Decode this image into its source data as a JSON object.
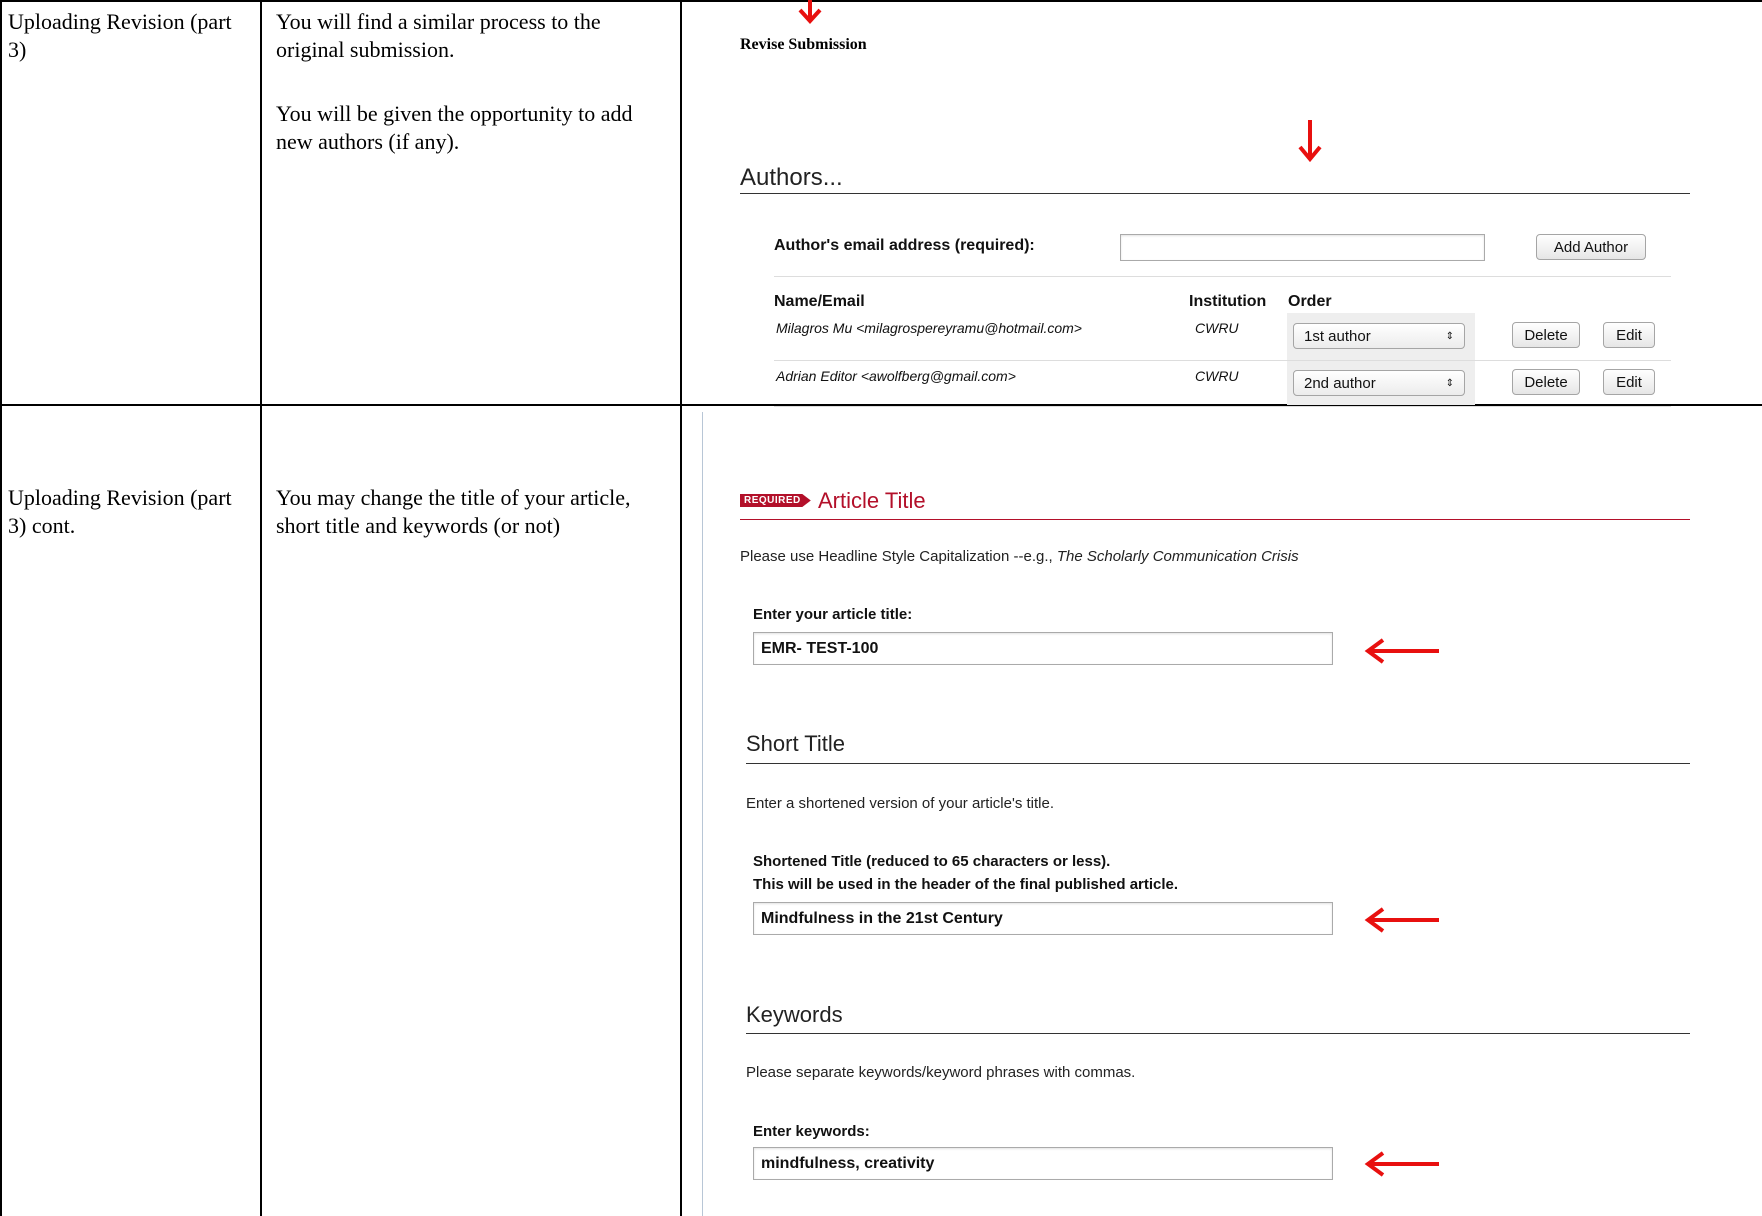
{
  "rows": [
    {
      "step": "Uploading Revision (part 3)",
      "description": [
        "You will find a similar process to the original submission.",
        "You will be given the opportunity to add new authors (if any)."
      ]
    },
    {
      "step": "Uploading Revision (part 3) cont.",
      "description": [
        "You may change the title of your article, short title and keywords (or not)"
      ]
    }
  ],
  "revise_screen": {
    "title": "Revise Submission",
    "authors_heading": "Authors...",
    "email_label": "Author's email address (required):",
    "email_value": "",
    "add_author_label": "Add Author",
    "columns": {
      "name": "Name/Email",
      "institution": "Institution",
      "order": "Order"
    },
    "authors": [
      {
        "name_email": "Milagros Mu <milagrospereyramu@hotmail.com>",
        "institution": "CWRU",
        "order": "1st author",
        "delete": "Delete",
        "edit": "Edit"
      },
      {
        "name_email": "Adrian Editor <awolfberg@gmail.com>",
        "institution": "CWRU",
        "order": "2nd author",
        "delete": "Delete",
        "edit": "Edit"
      }
    ]
  },
  "title_screen": {
    "required_badge": "REQUIRED",
    "article_title_heading": "Article Title",
    "article_help_prefix": "Please use Headline Style Capitalization --e.g., ",
    "article_help_example": "The Scholarly Communication Crisis",
    "article_title_label": "Enter your article title:",
    "article_title_value": "EMR- TEST-100",
    "short_title_heading": "Short Title",
    "short_title_help": "Enter a shortened version of your article's title.",
    "short_title_label_1": "Shortened Title (reduced to 65 characters or less).",
    "short_title_label_2": "This will be used in the header of the final published article.",
    "short_title_value": "Mindfulness in the 21st Century",
    "keywords_heading": "Keywords",
    "keywords_help": "Please separate keywords/keyword phrases with commas.",
    "keywords_label": "Enter keywords:",
    "keywords_value": "mindfulness, creativity"
  },
  "colors": {
    "accent_red": "#e8100f",
    "required_red": "#b3102a"
  },
  "icons": [
    "down-arrow-icon",
    "left-arrow-icon",
    "select-updown-icon"
  ]
}
